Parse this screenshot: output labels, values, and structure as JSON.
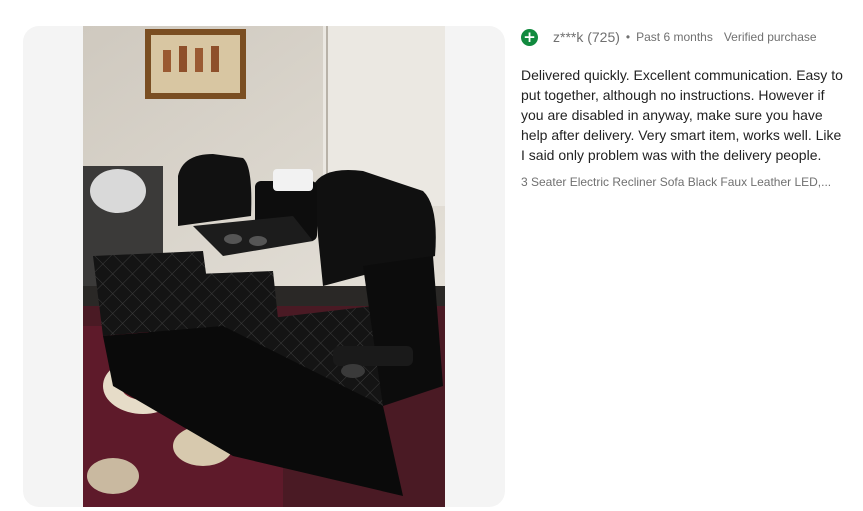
{
  "review": {
    "icon": "plus-circle-icon",
    "username": "z***k (725)",
    "separator": "•",
    "date": "Past 6 months",
    "verified": "Verified purchase",
    "text": "Delivered quickly. Excellent communication. Easy to put together, although no instructions. However if you are disabled in anyway, make sure you have help after delivery. Very smart item, works well. Like I said only problem was with the delivery people.",
    "product": "3 Seater Electric Recliner Sofa Black Faux Leather LED,..."
  },
  "colors": {
    "badge": "#118a3e",
    "meta_text": "#707070",
    "body_text": "#222222",
    "panel_bg": "#f4f4f4"
  }
}
